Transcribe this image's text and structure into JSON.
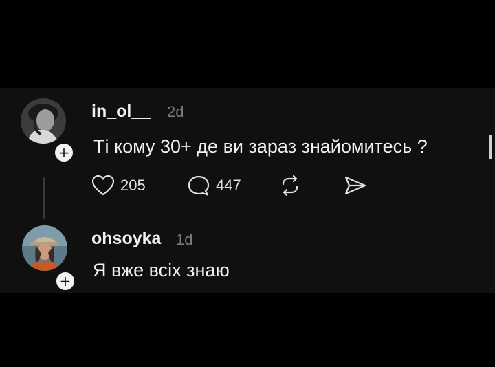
{
  "thread": {
    "post": {
      "username": "in_ol__",
      "time": "2d",
      "text": "Ті кому 30+ де ви зараз знайомитесь ?",
      "likes": "205",
      "comments": "447",
      "follow_badge": "+"
    },
    "reply": {
      "username": "ohsoyka",
      "time": "1d",
      "text": "Я вже всіх знаю",
      "follow_badge": "+"
    }
  }
}
